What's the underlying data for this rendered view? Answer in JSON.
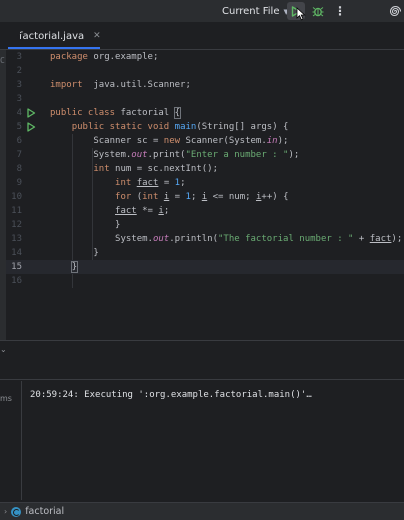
{
  "toolbar": {
    "run_config": "Current File",
    "more": "⋮"
  },
  "tab": {
    "label": "factorial.java",
    "close": "✕"
  },
  "left_edge_glyph": "C",
  "editor": {
    "lines": [
      {
        "num": "3",
        "text": "package org.example;"
      },
      {
        "num": "2",
        "text": ""
      },
      {
        "num": "3",
        "text": "import  java.util.Scanner;"
      },
      {
        "num": "3",
        "text": ""
      },
      {
        "num": "4",
        "text": "public class factorial {"
      },
      {
        "num": "5",
        "text": "    public static void main(String[] args) {"
      },
      {
        "num": "6",
        "text": "        Scanner sc = new Scanner(System.in);"
      },
      {
        "num": "7",
        "text": "        System.out.print(\"Enter a number : \");"
      },
      {
        "num": "8",
        "text": "        int num = sc.nextInt();"
      },
      {
        "num": "9",
        "text": "            int fact = 1;"
      },
      {
        "num": "10",
        "text": "            for (int i = 1; i <= num; i++) {"
      },
      {
        "num": "11",
        "text": "            fact *= i;"
      },
      {
        "num": "12",
        "text": "            }"
      },
      {
        "num": "13",
        "text": "            System.out.println(\"The factorial number : \" + fact);"
      },
      {
        "num": "14",
        "text": "        }"
      },
      {
        "num": "15",
        "text": "    }"
      },
      {
        "num": "16",
        "text": ""
      }
    ]
  },
  "panel": {
    "collapse_glyph": "⌄",
    "left_label": "ms"
  },
  "console": {
    "output": "20:59:24: Executing ':org.example.factorial.main()'…"
  },
  "statusbar": {
    "chevron": "›",
    "label": "factorial"
  },
  "colors": {
    "background": "#1e1f22",
    "accent": "#3574f0",
    "run_green": "#5fb865",
    "debug_green": "#5fb865",
    "keyword": "#cf8e6d",
    "method": "#56a8f5",
    "string": "#6aab73",
    "field": "#c77dbb"
  },
  "icons": [
    "play-icon",
    "debug-bug-icon",
    "more-vertical-icon",
    "ai-spiral-icon",
    "java-class-icon",
    "run-gutter-icon",
    "close-icon",
    "chevron-down-icon",
    "chevron-right-icon"
  ]
}
